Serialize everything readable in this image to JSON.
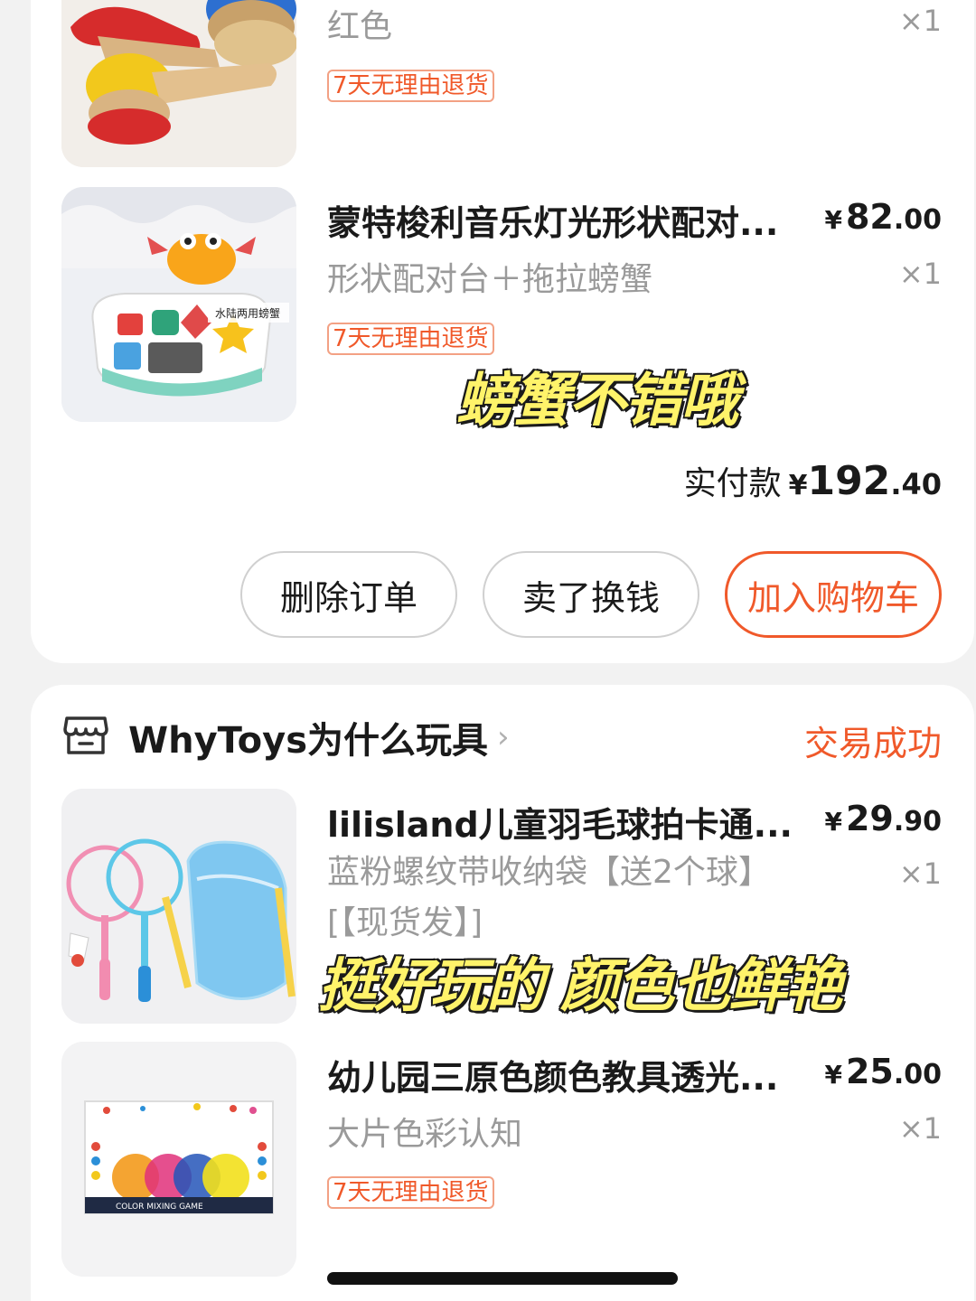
{
  "order1": {
    "item1": {
      "variant": "红色",
      "qty": "×1",
      "tag": "7天无理由退货"
    },
    "item2": {
      "title": "蒙特梭利音乐灯光形状配对...",
      "price_yen": "¥",
      "price_int": "82",
      "price_dec": ".00",
      "variant": "形状配对台＋拖拉螃蟹",
      "qty": "×1",
      "tag": "7天无理由退货",
      "image_label": "水陆两用螃蟹"
    },
    "total_label": "实付款",
    "total_yen": "¥",
    "total_int": "192",
    "total_dec": ".40",
    "buttons": {
      "delete": "删除订单",
      "resell": "卖了换钱",
      "add_cart": "加入购物车"
    }
  },
  "order2": {
    "shop_name": "WhyToys为什么玩具",
    "status": "交易成功",
    "item1": {
      "title": "lilisland儿童羽毛球拍卡通...",
      "price_yen": "¥",
      "price_int": "29",
      "price_dec": ".90",
      "variant": "蓝粉螺纹带收纳袋【送2个球】[【现货发】]",
      "qty": "×1"
    },
    "item2": {
      "title": "幼儿园三原色颜色教具透光...",
      "price_yen": "¥",
      "price_int": "25",
      "price_dec": ".00",
      "variant": "大片色彩认知",
      "qty": "×1",
      "tag": "7天无理由退货",
      "image_label": "COLOR MIXING GAME"
    }
  },
  "overlays": {
    "caption1": "螃蟹不错哦",
    "caption2": "挺好玩的 颜色也鲜艳"
  },
  "colors": {
    "accent": "#f0592a",
    "muted": "#9a9a9a",
    "caption": "#fff36a"
  },
  "icons": {
    "shop": "store-icon",
    "chevron": "chevron-right-icon"
  }
}
